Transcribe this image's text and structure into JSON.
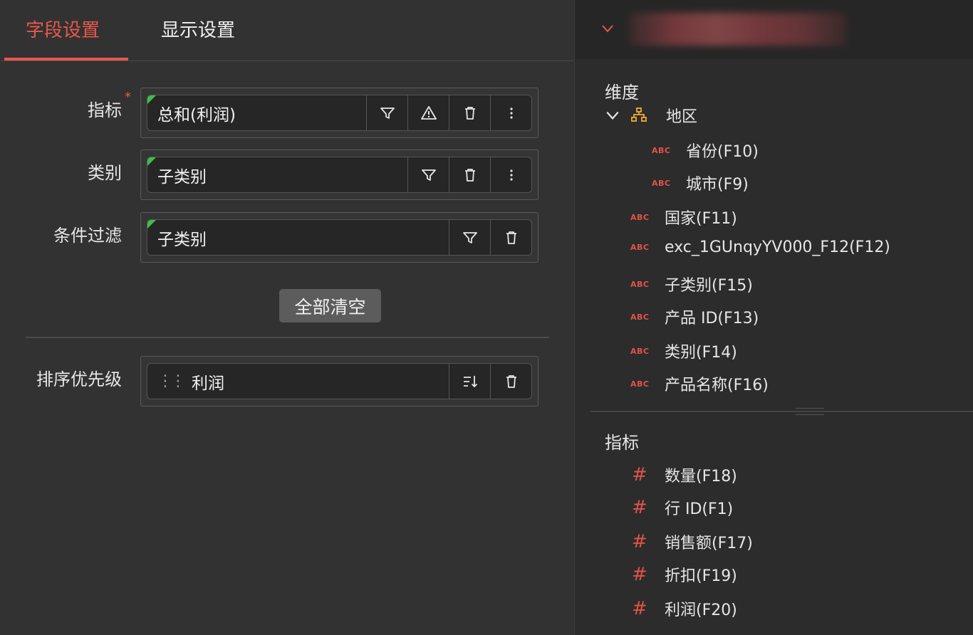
{
  "tabs": [
    {
      "label": "字段设置",
      "active": true
    },
    {
      "label": "显示设置",
      "active": false
    }
  ],
  "rows": {
    "metric": {
      "label": "指标",
      "required_mark": "*",
      "value": "总和(利润)"
    },
    "category": {
      "label": "类别",
      "value": "子类别"
    },
    "filter": {
      "label": "条件过滤",
      "value": "子类别"
    },
    "sort": {
      "label": "排序优先级",
      "value": "利润",
      "drag_handle": "⋮⋮"
    }
  },
  "clear_all_label": "全部清空",
  "right_panel": {
    "dimensions_title": "维度",
    "hierarchy": {
      "label": "地区",
      "children": [
        "省份(F10)",
        "城市(F9)"
      ]
    },
    "dimension_fields": [
      "国家(F11)",
      "exc_1GUnqyYV000_F12(F12)",
      "子类别(F15)",
      "产品 ID(F13)",
      "类别(F14)",
      "产品名称(F16)"
    ],
    "text_type_badge": "ABC",
    "measures_title": "指标",
    "measure_badge": "#",
    "measure_fields": [
      "数量(F18)",
      "行 ID(F1)",
      "销售额(F17)",
      "折扣(F19)",
      "利润(F20)"
    ]
  },
  "colors": {
    "accent": "#e8574d",
    "background": "#323232",
    "panel": "#2c2c2c",
    "field_bg": "#262626",
    "corner_flag": "#3fbf4a",
    "hierarchy_icon": "#e0a030"
  }
}
